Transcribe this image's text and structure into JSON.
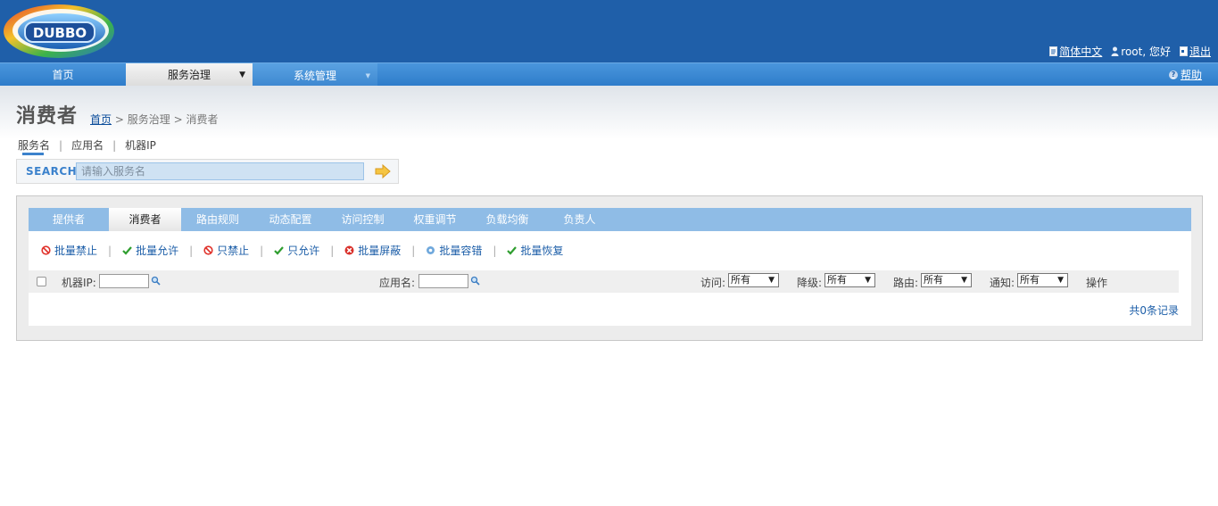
{
  "brand": {
    "logo_text": "DUBBO"
  },
  "user_links": {
    "language": "简体中文",
    "greeting": "root, 您好",
    "logout": "退出"
  },
  "nav": {
    "items": [
      {
        "label": "首页"
      },
      {
        "label": "服务治理"
      },
      {
        "label": "系统管理"
      }
    ],
    "help": "帮助"
  },
  "page": {
    "title": "消费者",
    "breadcrumb": {
      "home": "首页",
      "sep": ">",
      "section": "服务治理",
      "current": "消费者"
    }
  },
  "search": {
    "types": [
      "服务名",
      "应用名",
      "机器IP"
    ],
    "label": "SEARCH",
    "placeholder": "请输入服务名"
  },
  "tabs": [
    "提供者",
    "消费者",
    "路由规则",
    "动态配置",
    "访问控制",
    "权重调节",
    "负载均衡",
    "负责人"
  ],
  "actions": [
    {
      "label": "批量禁止",
      "icon": "ban-icon"
    },
    {
      "label": "批量允许",
      "icon": "check-icon"
    },
    {
      "label": "只禁止",
      "icon": "ban-icon"
    },
    {
      "label": "只允许",
      "icon": "check-icon"
    },
    {
      "label": "批量屏蔽",
      "icon": "block-icon"
    },
    {
      "label": "批量容错",
      "icon": "gear-icon"
    },
    {
      "label": "批量恢复",
      "icon": "check-icon"
    }
  ],
  "filters": {
    "ip_label": "机器IP:",
    "app_label": "应用名:",
    "access_label": "访问:",
    "access_value": "所有",
    "degrade_label": "降级:",
    "degrade_value": "所有",
    "route_label": "路由:",
    "route_value": "所有",
    "notify_label": "通知:",
    "notify_value": "所有",
    "ops_label": "操作"
  },
  "total": "共0条记录",
  "colors": {
    "header": "#1f5fa9",
    "nav": "#3d87d0",
    "tabbar": "#8fbce6",
    "link": "#1c5ea8"
  }
}
